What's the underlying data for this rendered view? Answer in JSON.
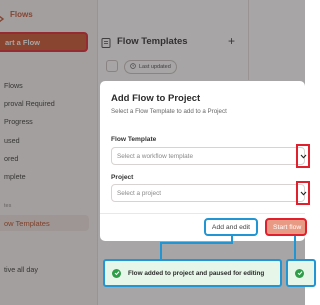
{
  "sidebar": {
    "brand": "Flows",
    "start_button": "art a Flow",
    "items": [
      "Flows",
      "proval Required",
      "Progress",
      "used",
      "ored",
      "mplete"
    ],
    "section_label": "tes",
    "active_item": "ow Templates",
    "alert_item": "tive all day"
  },
  "panel": {
    "title": "Flow Templates",
    "plus": "+",
    "sort_chip": "Last updated"
  },
  "dialog": {
    "title": "Add Flow to Project",
    "subtitle": "Select a Flow Template to add to a Project",
    "template_label": "Flow Template",
    "template_placeholder": "Select a workflow template",
    "project_label": "Project",
    "project_placeholder": "Select a project",
    "add_edit_button": "Add and edit",
    "start_button": "Start flow"
  },
  "toasts": [
    "Flow added to project and paused for editing",
    ""
  ],
  "colors": {
    "accent": "#c9502a",
    "highlight_red": "#e0202c",
    "highlight_blue": "#2196d3",
    "success": "#2e9d48"
  }
}
